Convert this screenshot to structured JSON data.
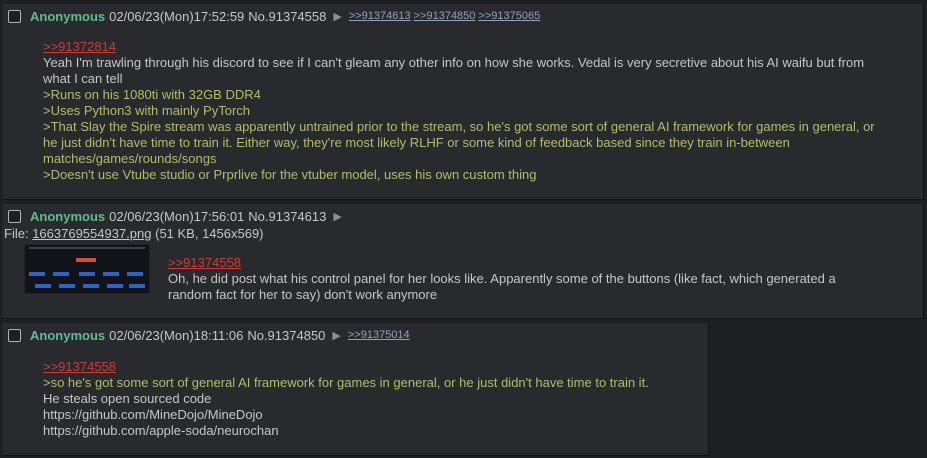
{
  "posts": [
    {
      "name": "Anonymous",
      "datetime": "02/06/23(Mon)17:52:59",
      "number": "No.91374558",
      "backlinks": [
        ">>91374613",
        ">>91374850",
        ">>91375065"
      ],
      "lines": [
        {
          "type": "reply",
          "text": ">>91372814"
        },
        {
          "type": "text",
          "text": "Yeah I'm trawling through his discord to see if I can't gleam any other info on how she works. Vedal is very secretive about his AI waifu but from what I can tell"
        },
        {
          "type": "quote",
          "text": ">Runs on his 1080ti with 32GB DDR4"
        },
        {
          "type": "quote",
          "text": ">Uses Python3 with mainly PyTorch"
        },
        {
          "type": "quote",
          "text": ">That Slay the Spire stream was apparently untrained prior to the stream, so he's got some sort of general AI framework for games in general, or he just didn't have time to train it. Either way, they're most likely RLHF or some kind of feedback based since they train in-between matches/games/rounds/songs"
        },
        {
          "type": "quote",
          "text": ">Doesn't use Vtube studio or Prprlive for the vtuber model, uses his own custom thing"
        }
      ]
    },
    {
      "name": "Anonymous",
      "datetime": "02/06/23(Mon)17:56:01",
      "number": "No.91374613",
      "file": {
        "label": "File:",
        "filename": "1663769554937.png",
        "info": "(51 KB, 1456x569)"
      },
      "lines": [
        {
          "type": "reply",
          "text": ">>91374558"
        },
        {
          "type": "text",
          "text": "Oh, he did post what his control panel for her looks like. Apparently some of the buttons (like fact, which generated a random fact for her to say) don't work anymore"
        }
      ]
    },
    {
      "name": "Anonymous",
      "datetime": "02/06/23(Mon)18:11:06",
      "number": "No.91374850",
      "backlinks": [
        ">>91375014"
      ],
      "lines": [
        {
          "type": "reply",
          "text": ">>91374558"
        },
        {
          "type": "quote",
          "text": ">so he's got some sort of general AI framework for games in general, or he just didn't have time to train it."
        },
        {
          "type": "text",
          "text": "He steals open sourced code"
        },
        {
          "type": "text",
          "text": "https://github.com/MineDojo/MineDojo"
        },
        {
          "type": "text",
          "text": "https://github.com/apple-soda/neurochan"
        }
      ]
    }
  ],
  "icons": {
    "post_menu": "triangle-right-icon",
    "select": "checkbox-icon"
  },
  "colors": {
    "background": "#1d1f21",
    "post": "#282a2e",
    "name": "#5fbf8d",
    "greentext": "#b5bd68",
    "quotelink": "#d03b36",
    "text": "#c5c8c6"
  }
}
